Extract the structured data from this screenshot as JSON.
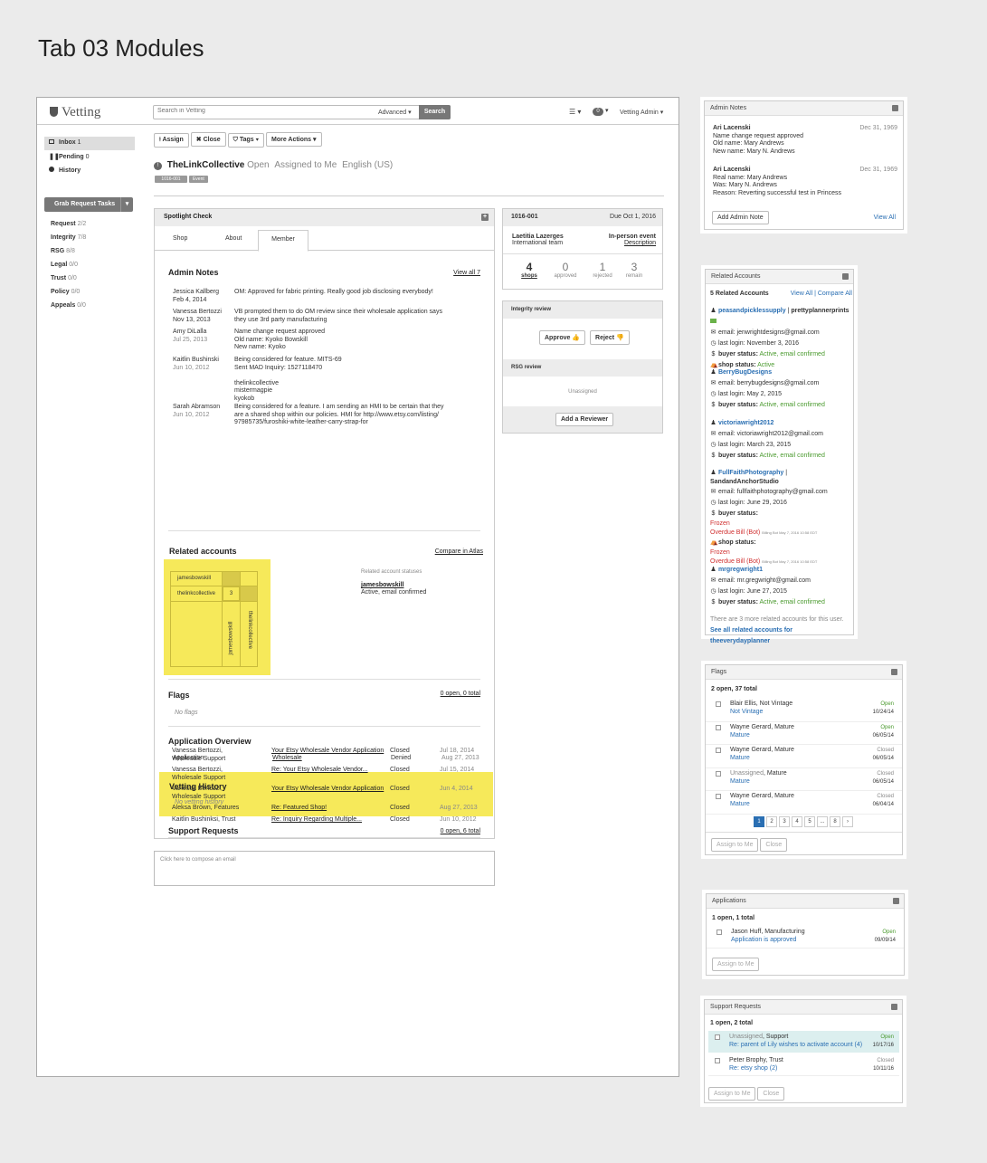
{
  "page_title": "Tab 03 Modules",
  "app": {
    "name": "Vetting"
  },
  "search": {
    "placeholder": "Search in Vetting",
    "advanced": "Advanced",
    "button": "Search"
  },
  "header": {
    "badge": "0",
    "user": "Vetting Admin"
  },
  "sidebar": {
    "items": [
      {
        "label": "Inbox",
        "count": "1"
      },
      {
        "label": "Pending",
        "count": "0"
      },
      {
        "label": "History",
        "count": ""
      }
    ],
    "grab_button": "Grab Request Tasks",
    "tasks": [
      {
        "label": "Request",
        "count": "2/2"
      },
      {
        "label": "Integrity",
        "count": "7/8"
      },
      {
        "label": "RSG",
        "count": "8/8"
      },
      {
        "label": "Legal",
        "count": "0/0"
      },
      {
        "label": "Trust",
        "count": "0/0"
      },
      {
        "label": "Policy",
        "count": "0/0"
      },
      {
        "label": "Appeals",
        "count": "0/0"
      }
    ]
  },
  "toolbar": {
    "assign": "Assign",
    "close": "Close",
    "tags": "Tags",
    "more": "More Actions"
  },
  "request": {
    "name": "TheLinkCollective",
    "status": "Open",
    "assigned": "Assigned to Me",
    "lang": "English (US)",
    "tags": [
      "1016-001",
      "Event"
    ]
  },
  "spotlight": {
    "title": "Spotlight Check",
    "tabs": [
      "Shop",
      "About",
      "Member"
    ],
    "admin_notes": {
      "title": "Admin Notes",
      "view_all": "View all 7",
      "notes": [
        {
          "author": "Jessica Kallberg",
          "date": "Feb 4, 2014",
          "lines": [
            "OM: Approved for fabric printing. Really good job disclosing everybody!"
          ]
        },
        {
          "author": "Vanessa Bertozzi",
          "date": "Nov 13, 2013",
          "lines": [
            "VB prompted them to do OM review since their wholesale application says",
            "they use 3rd party manufacturing"
          ]
        },
        {
          "author": "Amy DiLalla",
          "date": "Jul 25, 2013",
          "lines": [
            "Name change request approved",
            "Old name: Kyoko Bowskill",
            "New name: Kyoko"
          ]
        },
        {
          "author": "Kaitlin Bushinski",
          "date": "Jun 10, 2012",
          "lines": [
            "Being considered for feature. MITS-69",
            "Sent MAD Inquiry: 1527118470",
            "",
            "thelinkcollective",
            "mistermagpie",
            "kyokob"
          ]
        },
        {
          "author": "Sarah Abramson",
          "date": "Jun 10, 2012",
          "lines": [
            "Being considered for a feature. I am sending an HMI to be certain that they",
            "are a shared shop within our policies. HMI for http://www.etsy.com/listing/",
            "97985735/furoshiki-white-leather-carry-strap-for"
          ]
        }
      ]
    },
    "related": {
      "title": "Related accounts",
      "compare": "Compare in Atlas",
      "matrix_rows": [
        "jamesbowskill",
        "thelinkcollective"
      ],
      "matrix_cols": [
        "jamesbowskill",
        "thelinkcollective"
      ],
      "matrix_value": "3",
      "statuses_label": "Related account statuses",
      "status_name": "jamesbowskill",
      "status_value": "Active, email confirmed"
    },
    "flags": {
      "title": "Flags",
      "summary": "0 open, 0 total",
      "empty": "No flags"
    },
    "app_overview": {
      "title": "Application Overview",
      "row": {
        "type": "Application",
        "kind": "Wholesale",
        "status": "Denied",
        "date": "Aug 27, 2013"
      }
    },
    "vetting_history": {
      "title": "Vetting History",
      "empty": "No vetting history"
    },
    "support": {
      "title": "Support Requests",
      "summary": "0 open, 6 total",
      "rows": [
        {
          "who": "Vanessa Bertozzi, Wholesale Support",
          "subject": "Your Etsy Wholesale Vendor Application",
          "status": "Closed",
          "date": "Jul 18, 2014"
        },
        {
          "who": "Vanessa Bertozzi, Wholesale Support",
          "subject": "Re: Your Etsy Wholesale Vendor...",
          "status": "Closed",
          "date": "Jul 15, 2014"
        },
        {
          "who": "Vanessa Bertozzi, Wholesale Support",
          "subject": "Your Etsy Wholesale Vendor Application",
          "status": "Closed",
          "date": "Jun 4, 2014"
        },
        {
          "who": "Aleksa Brown, Features",
          "subject": "Re: Featured Shop!",
          "status": "Closed",
          "date": "Aug 27, 2013"
        },
        {
          "who": "Kaitlin Bushinksi, Trust",
          "subject": "Re: Inquiry Regarding Multiple...",
          "status": "Closed",
          "date": "Jun 10, 2012"
        }
      ]
    },
    "compose_placeholder": "Click here to compose an email"
  },
  "review_card": {
    "id": "1016-001",
    "due": "Due Oct 1, 2016",
    "person": "Laetitia Lazerges",
    "team": "International team",
    "event": "In-person event",
    "description": "Description",
    "stats": [
      {
        "value": "4",
        "label": "shops"
      },
      {
        "value": "0",
        "label": "approved"
      },
      {
        "value": "1",
        "label": "rejected"
      },
      {
        "value": "3",
        "label": "remain"
      }
    ],
    "integrity": "Integrity review",
    "approve": "Approve",
    "reject": "Reject",
    "rsg": "RSG review",
    "unassigned": "Unassigned",
    "add_reviewer": "Add a Reviewer"
  },
  "admin_notes_panel": {
    "title": "Admin Notes",
    "notes": [
      {
        "author": "Ari Lacenski",
        "date": "Dec 31, 1969",
        "lines": [
          "Name change request approved",
          "Old name: Mary Andrews",
          "New name: Mary N. Andrews"
        ]
      },
      {
        "author": "Ari Lacenski",
        "date": "Dec 31, 1969",
        "lines": [
          "Real name: Mary Andrews",
          "Was: Mary N. Andrews",
          "Reason: Reverting successful test in Princess"
        ]
      }
    ],
    "add": "Add Admin Note",
    "view_all": "View All"
  },
  "related_panel": {
    "title": "Related Accounts",
    "count": "5 Related Accounts",
    "view_all": "View All",
    "compare_all": "Compare All",
    "accounts": [
      {
        "name": "peasandpicklessupply",
        "alt": "prettyplannerprints",
        "email": "email: jenwrightdesigns@gmail.com",
        "login": "last login: November 3, 2016",
        "buyer": "Active, email confirmed",
        "shop": "Active"
      },
      {
        "name": "BerryBugDesigns",
        "email": "email: berrybugdesigns@gmail.com",
        "login": "last login: May 2, 2015",
        "buyer": "Active, email confirmed"
      },
      {
        "name": "victoriawright2012",
        "email": "email: victoriawright2012@gmail.com",
        "login": "last login: March 23, 2015",
        "buyer": "Active, email confirmed"
      },
      {
        "name": "FullFaithPhotography",
        "alt": "SandandAnchorStudio",
        "email": "email: fullfaithphotography@gmail.com",
        "login": "last login: June 29, 2016"
      },
      {
        "name": "mrgregwright1",
        "email": "email: mr.gregwright@gmail.com",
        "login": "last login: June 27, 2015",
        "buyer": "Active, email confirmed"
      }
    ],
    "buyer_label": "buyer status:",
    "shop_label": "shop status:",
    "frozen": "Frozen",
    "overdue": "Overdue Bill (Bot)",
    "billing_note": "Billing Bot May 7, 2016 10:58 EDT",
    "more_note": "There are 3 more related accounts for this user.",
    "see_all": "See all related accounts for theeverydayplanner"
  },
  "flags_panel": {
    "title": "Flags",
    "summary": "2 open, 37 total",
    "rows": [
      {
        "who": "Blair Ellis, Not Vintage",
        "sub": "Not Vintage",
        "status": "Open",
        "date": "10/24/14"
      },
      {
        "who": "Wayne Gerard, Mature",
        "sub": "Mature",
        "status": "Open",
        "date": "06/05/14"
      },
      {
        "who": "Wayne Gerard, Mature",
        "sub": "Mature",
        "status": "Closed",
        "date": "06/05/14"
      },
      {
        "who": "Unassigned",
        "who2": ", Mature",
        "sub": "Mature",
        "status": "Closed",
        "date": "06/05/14"
      },
      {
        "who": "Wayne Gerard, Mature",
        "sub": "Mature",
        "status": "Closed",
        "date": "06/04/14"
      }
    ],
    "pages": [
      "1",
      "2",
      "3",
      "4",
      "5",
      "...",
      "8",
      "›"
    ],
    "assign": "Assign to Me",
    "close": "Close"
  },
  "applications_panel": {
    "title": "Applications",
    "summary": "1 open, 1 total",
    "row": {
      "who": "Jason Huff, Manufacturing",
      "sub": "Application is approved",
      "status": "Open",
      "date": "09/09/14"
    },
    "assign": "Assign to Me"
  },
  "support_panel": {
    "title": "Support Requests",
    "summary": "1 open, 2 total",
    "rows": [
      {
        "who": "Unassigned",
        "who2": ", Support",
        "sub": "Re: parent of Lily wishes to activate account (4)",
        "status": "Open",
        "date": "10/17/16"
      },
      {
        "who": "Peter Brophy, Trust",
        "sub": "Re: etsy shop (2)",
        "status": "Closed",
        "date": "10/11/16"
      }
    ],
    "assign": "Assign to Me",
    "close": "Close"
  }
}
